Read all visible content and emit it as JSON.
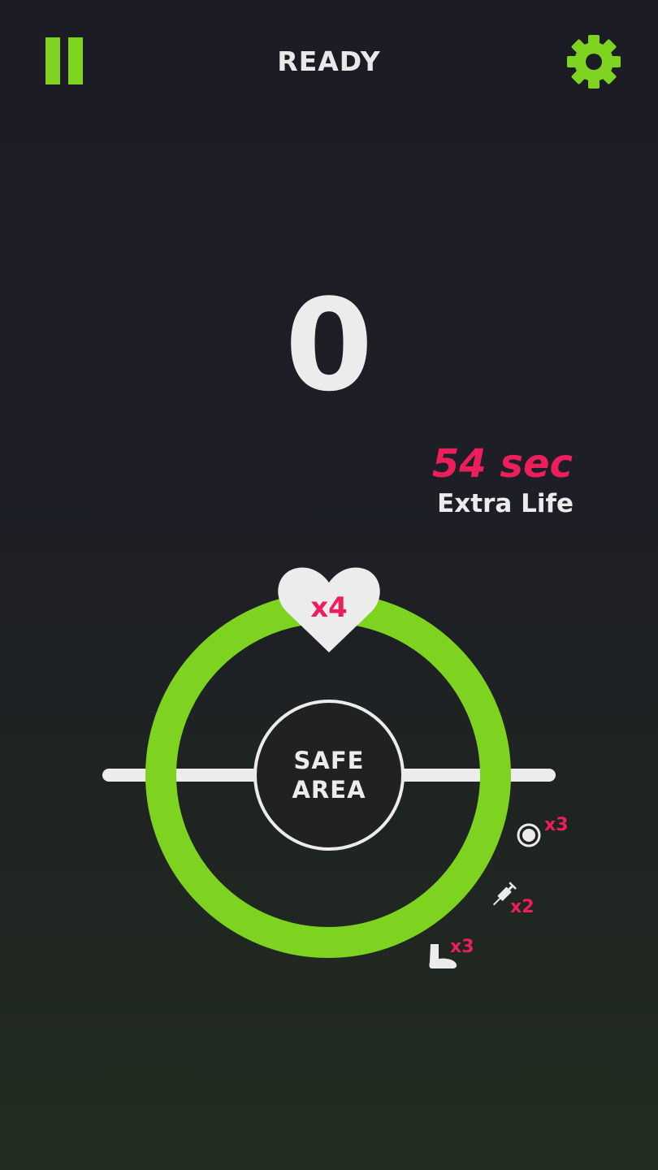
{
  "header": {
    "title": "READY",
    "pause_icon": "pause-icon",
    "settings_icon": "gear-icon"
  },
  "score": "0",
  "extra_life": {
    "timer": "54 sec",
    "label": "Extra Life"
  },
  "lives": {
    "count": "x4",
    "icon": "heart-icon"
  },
  "safe_area": {
    "line1": "SAFE",
    "line2": "AREA"
  },
  "items": [
    {
      "icon": "target-icon",
      "count": "x3"
    },
    {
      "icon": "syringe-icon",
      "count": "x2"
    },
    {
      "icon": "foot-icon",
      "count": "x3"
    }
  ],
  "colors": {
    "accent": "#7ed321",
    "danger": "#ec1e5c",
    "text": "#ececec",
    "background": "#1c1c24"
  }
}
